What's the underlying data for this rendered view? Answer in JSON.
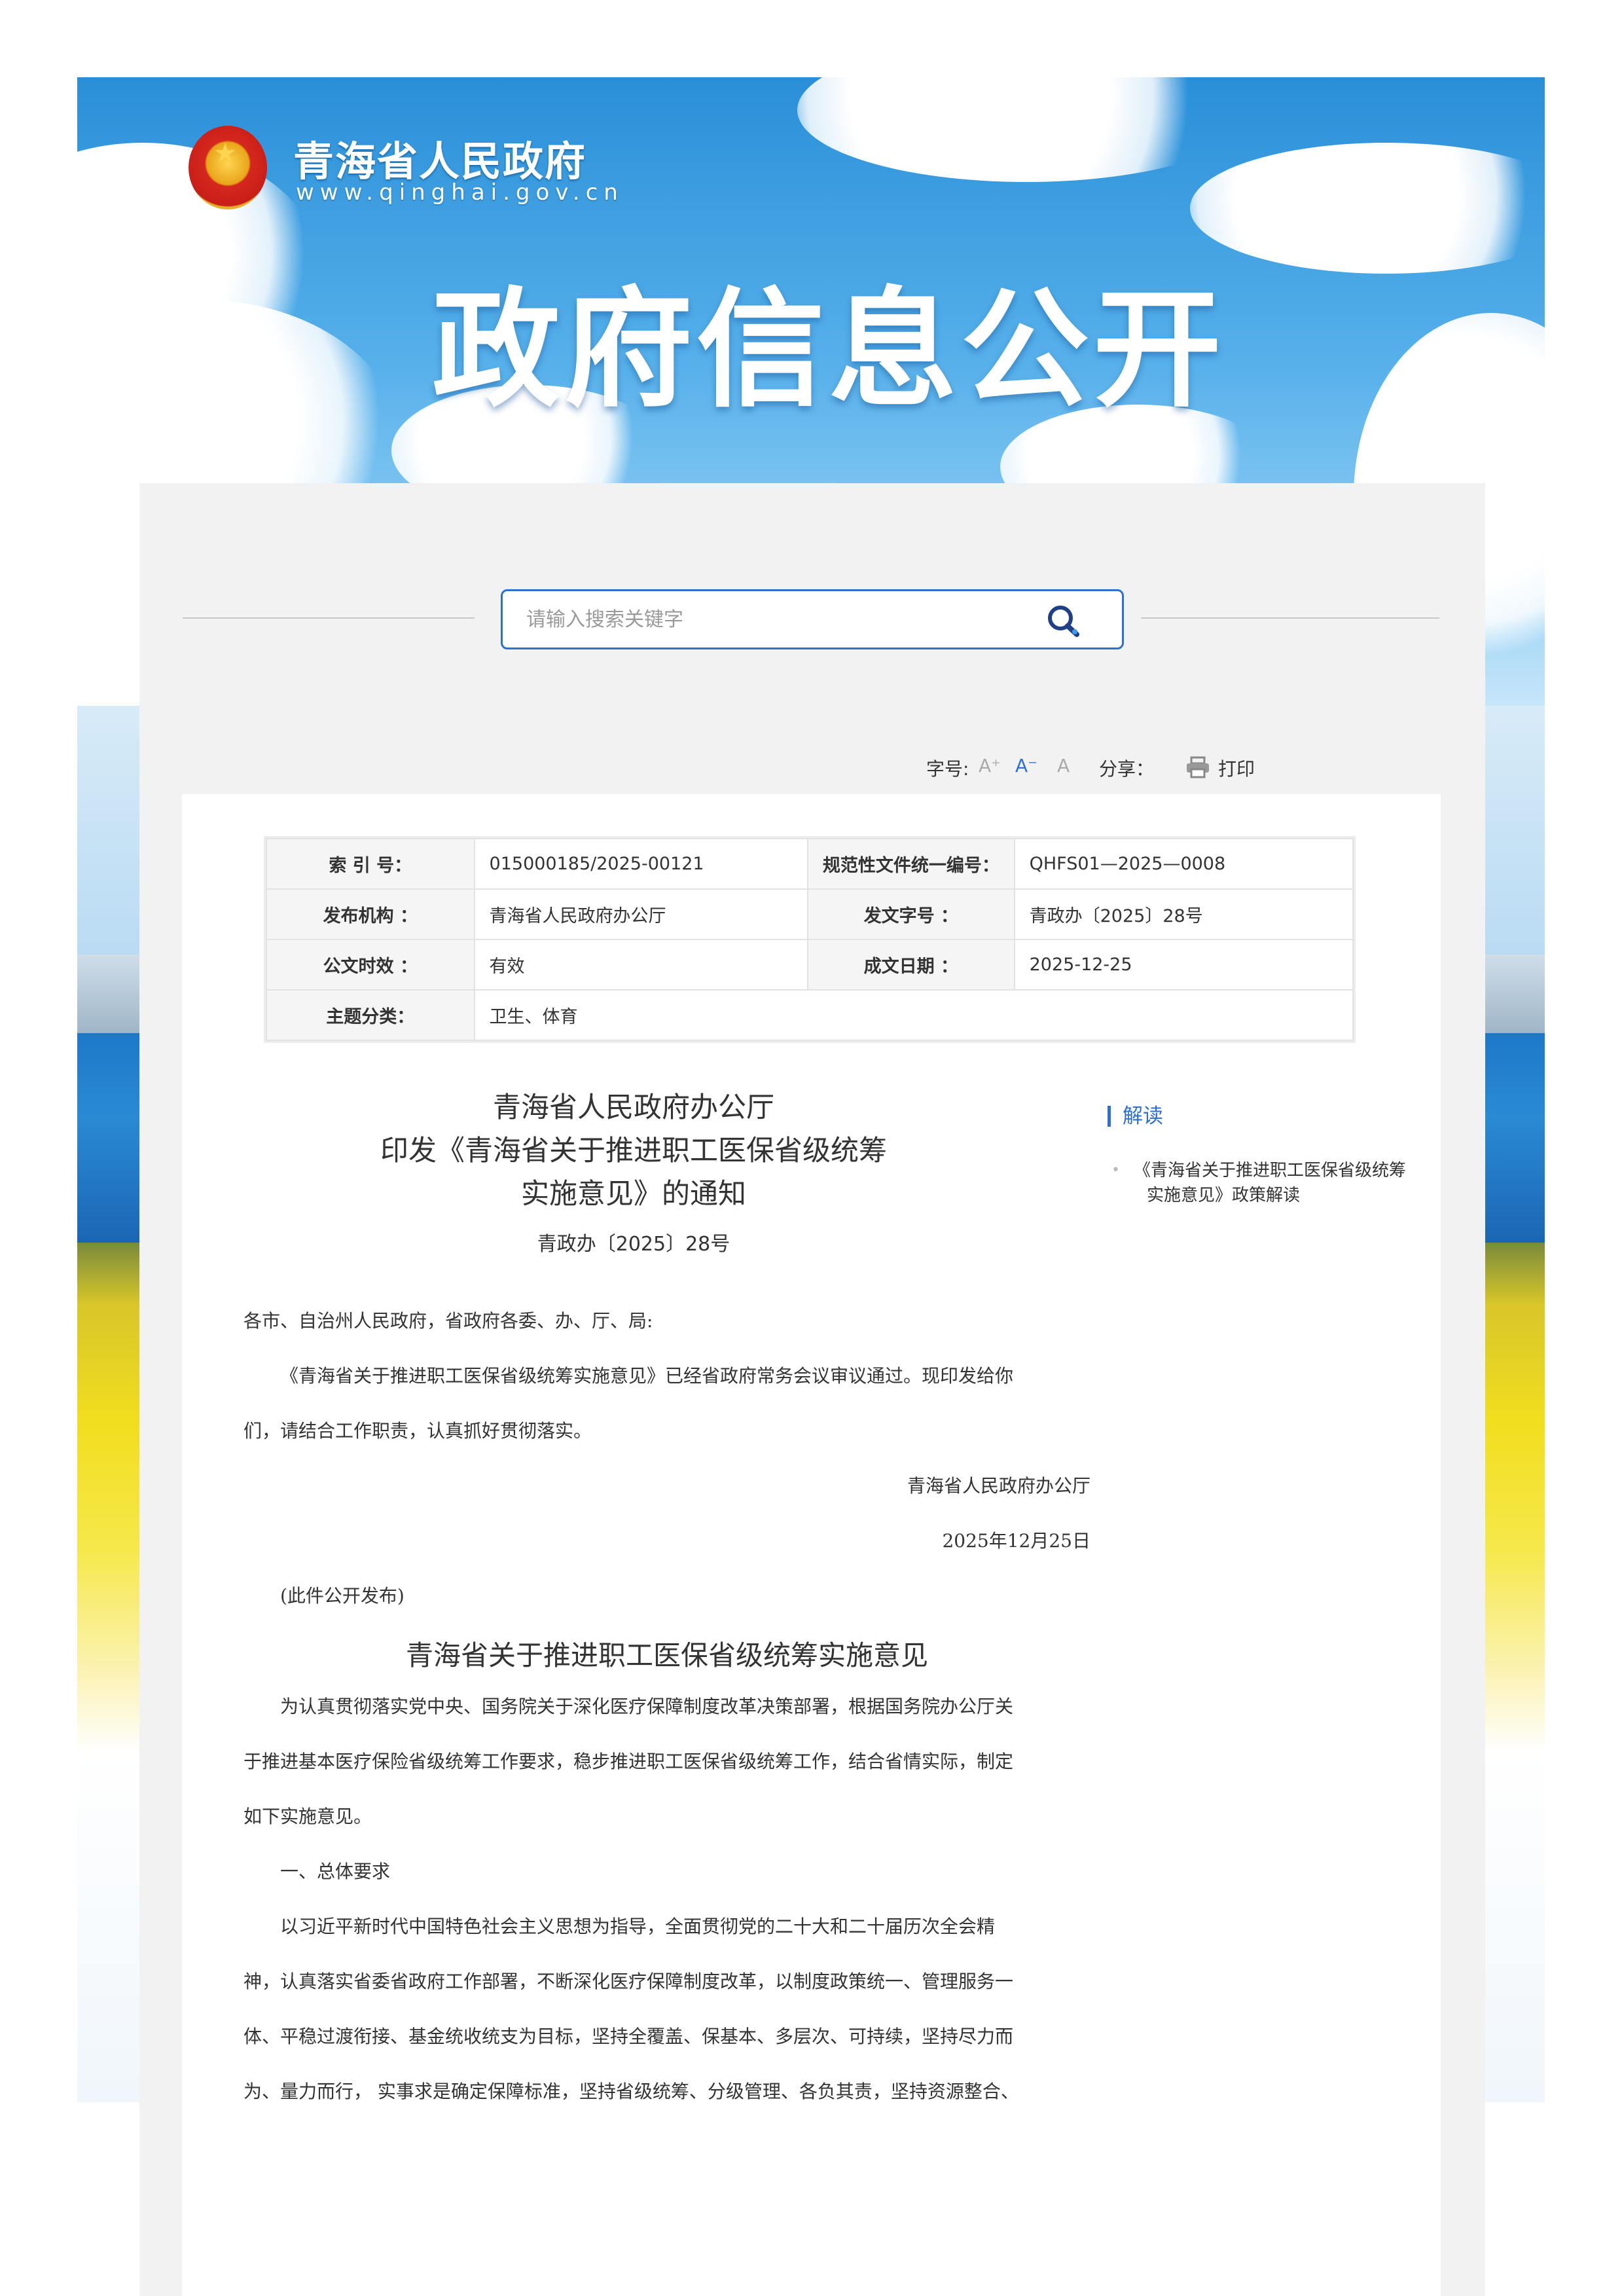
{
  "header": {
    "site_name": "青海省人民政府",
    "site_url": "www.qinghai.gov.cn",
    "banner_title": "政府信息公开"
  },
  "search": {
    "placeholder": "请输入搜索关键字"
  },
  "toolbar": {
    "font_size_label": "字号:",
    "font_larger": "A⁺",
    "font_smaller": "A⁻",
    "font_default": "A",
    "share_label": "分享：",
    "print_label": "打印"
  },
  "meta": {
    "index_label": "索 引 号：",
    "index_value": "015000185/2025-00121",
    "code_label": "规范性文件统一编号：",
    "code_value": "QHFS01—2025—0008",
    "issuer_label": "发布机构 ：",
    "issuer_value": "青海省人民政府办公厅",
    "doc_no_label": "发文字号 ：",
    "doc_no_value": "青政办〔2025〕28号",
    "validity_label": "公文时效 ：",
    "validity_value": "有效",
    "date_label": "成文日期 ：",
    "date_value": "2025-12-25",
    "topic_label": "主题分类：",
    "topic_value": "卫生、体育"
  },
  "doc": {
    "title_line1": "青海省人民政府办公厅",
    "title_line2": "印发《青海省关于推进职工医保省级统筹",
    "title_line3": "实施意见》的通知",
    "doc_number": "青政办〔2025〕28号",
    "salutation": "各市、自治州人民政府，省政府各委、办、厅、局:",
    "body_line1": "《青海省关于推进职工医保省级统筹实施意见》已经省政府常务会议审议通过。现印发给你",
    "body_line2": "们，请结合工作职责，认真抓好贯彻落实。",
    "signature": "青海省人民政府办公厅",
    "sign_date": "2025年12月25日",
    "publish_note": "(此件公开发布)",
    "sub_title": "青海省关于推进职工医保省级统筹实施意见",
    "intro_line1": "为认真贯彻落实党中央、国务院关于深化医疗保障制度改革决策部署，根据国务院办公厅关",
    "intro_line2": "于推进基本医疗保险省级统筹工作要求，稳步推进职工医保省级统筹工作，结合省情实际，制定",
    "intro_line3": "如下实施意见。",
    "section1": "一、总体要求",
    "s1_line1": "以习近平新时代中国特色社会主义思想为指导，全面贯彻党的二十大和二十届历次全会精",
    "s1_line2": "神，认真落实省委省政府工作部署，不断深化医疗保障制度改革，以制度政策统一、管理服务一",
    "s1_line3": "体、平稳过渡衔接、基金统收统支为目标，坚持全覆盖、保基本、多层次、可持续，坚持尽力而",
    "s1_line4": "为、量力而行， 实事求是确定保障标准，坚持省级统筹、分级管理、各负其责，坚持资源整合、"
  },
  "sidebar": {
    "heading": "解读",
    "item1_line1": "《青海省关于推进职工医保省级统筹",
    "item1_line2": "实施意见》政策解读"
  },
  "colors": {
    "accent": "#2e6fd1",
    "panel_bg": "#f2f2f2",
    "label_bg": "#f5f5f5"
  }
}
